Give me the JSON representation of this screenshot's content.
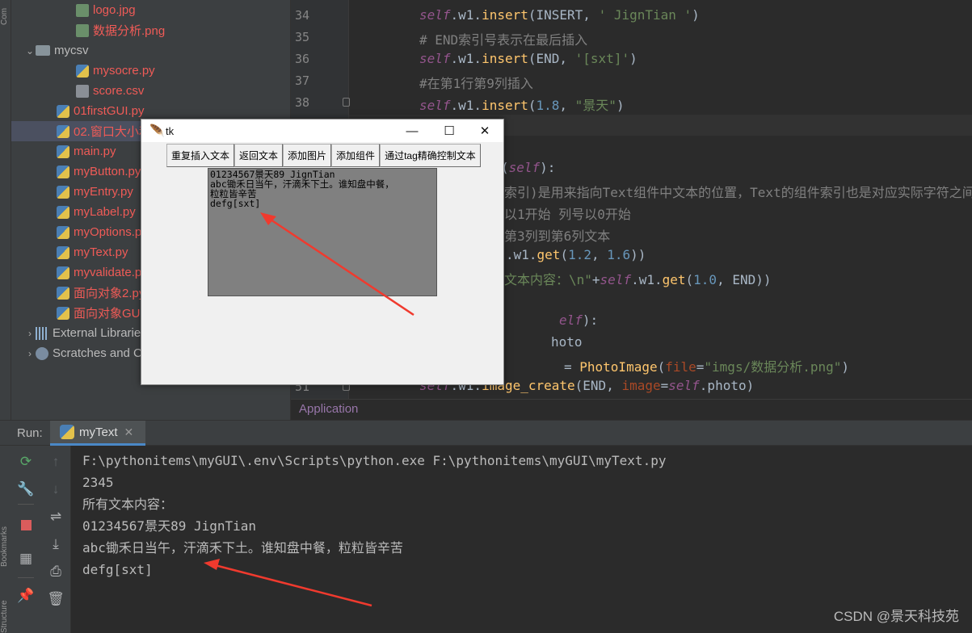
{
  "side_labels": {
    "top": "Com",
    "bookmarks": "Bookmarks",
    "structure": "Structure"
  },
  "project_tree": [
    {
      "label": "logo.jpg",
      "icon": "image-icon",
      "color": "red",
      "indent": 80
    },
    {
      "label": "数据分析.png",
      "icon": "image-icon",
      "color": "red",
      "indent": 80
    },
    {
      "label": "mycsv",
      "icon": "folder-icon",
      "color": "norm",
      "indent": 30,
      "expanded": true
    },
    {
      "label": "mysocre.py",
      "icon": "python-file-icon",
      "color": "red",
      "indent": 80
    },
    {
      "label": "score.csv",
      "icon": "text-file-icon",
      "color": "red",
      "indent": 80
    },
    {
      "label": "01firstGUI.py",
      "icon": "python-file-icon",
      "color": "red",
      "indent": 56
    },
    {
      "label": "02.窗口大小和",
      "icon": "python-file-icon",
      "color": "red",
      "indent": 56,
      "selected": true
    },
    {
      "label": "main.py",
      "icon": "python-file-icon",
      "color": "red",
      "indent": 56
    },
    {
      "label": "myButton.py",
      "icon": "python-file-icon",
      "color": "red",
      "indent": 56
    },
    {
      "label": "myEntry.py",
      "icon": "python-file-icon",
      "color": "red",
      "indent": 56
    },
    {
      "label": "myLabel.py",
      "icon": "python-file-icon",
      "color": "red",
      "indent": 56
    },
    {
      "label": "myOptions.p",
      "icon": "python-file-icon",
      "color": "red",
      "indent": 56
    },
    {
      "label": "myText.py",
      "icon": "python-file-icon",
      "color": "red",
      "indent": 56
    },
    {
      "label": "myvalidate.p",
      "icon": "python-file-icon",
      "color": "red",
      "indent": 56
    },
    {
      "label": "面向对象2.py",
      "icon": "python-file-icon",
      "color": "red",
      "indent": 56
    },
    {
      "label": "面向对象GUI.",
      "icon": "python-file-icon",
      "color": "red",
      "indent": 56
    },
    {
      "label": "External Librarie",
      "icon": "library-icon",
      "color": "norm",
      "indent": 30,
      "collapsed": true
    },
    {
      "label": "Scratches and C",
      "icon": "scratches-icon",
      "color": "norm",
      "indent": 30,
      "collapsed": true
    }
  ],
  "editor": {
    "line_numbers": [
      "34",
      "35",
      "36",
      "37",
      "38",
      "51"
    ],
    "breadcrumb": "Application"
  },
  "run_panel": {
    "label": "Run:",
    "tab_label": "myText",
    "console_lines": [
      "F:\\pythonitems\\myGUI\\.env\\Scripts\\python.exe F:\\pythonitems\\myGUI\\myText.py",
      "2345",
      "所有文本内容：",
      "01234567景天89 JignTian",
      "abc锄禾日当午，汗滴禾下土。谁知盘中餐，粒粒皆辛苦",
      "defg[sxt]"
    ],
    "watermark": "CSDN @景天科技苑"
  },
  "tk_window": {
    "title": "tk",
    "buttons": [
      "重复插入文本",
      "返回文本",
      "添加图片",
      "添加组件",
      "通过tag精确控制文本"
    ],
    "text_lines": [
      "01234567景天89 JignTian",
      "abc锄禾日当午，汗滴禾下土。谁知盘中餐，",
      "粒粒皆辛苦",
      "defg[sxt]"
    ]
  },
  "colors": {
    "annotation_arrow": "#f03a2e"
  }
}
